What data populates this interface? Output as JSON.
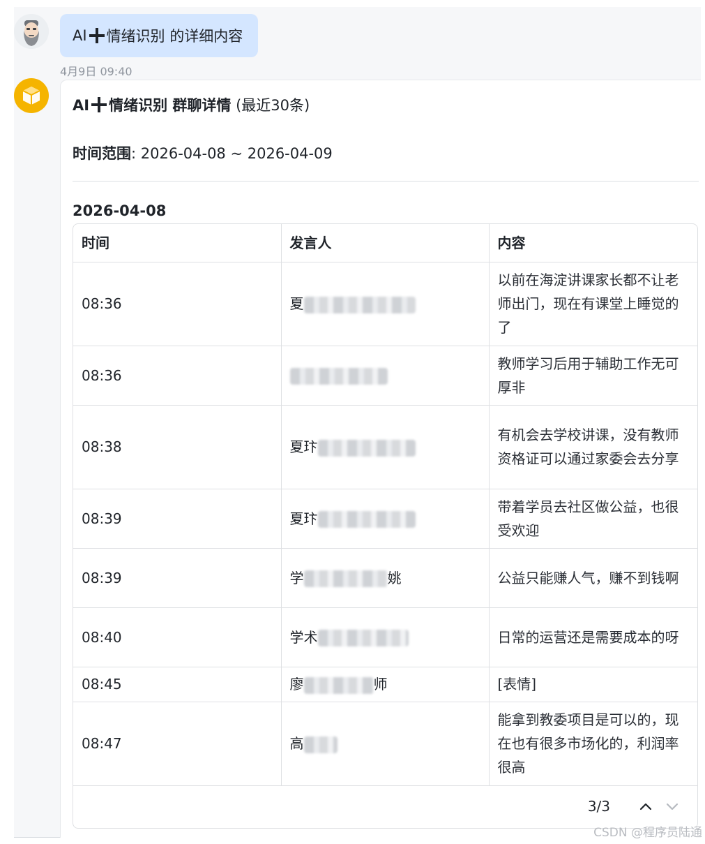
{
  "user_message": {
    "prefix": "AI",
    "suffix": "情绪识别  的详细内容",
    "timestamp": "4月9日 09:40"
  },
  "icons": {
    "user_avatar": "bearded-man-avatar",
    "bot_avatar": "cube-box-icon",
    "plus": "plus-icon",
    "pager_prev": "chevron-up-icon",
    "pager_next": "chevron-down-icon"
  },
  "colors": {
    "user_bubble": "#d4e6ff",
    "bot_avatar": "#f5b400",
    "border": "#dee0e3"
  },
  "bot_card": {
    "title_prefix": "AI",
    "title_bold": "情绪识别 群聊详情",
    "title_suffix": " (最近30条)",
    "range_label": "时间范围",
    "range_value": ": 2026-04-08 ~ 2026-04-09",
    "date_heading": "2026-04-08",
    "columns": [
      "时间",
      "发言人",
      "内容"
    ],
    "rows": [
      {
        "time": "08:36",
        "speaker": "夏",
        "content": "以前在海淀讲课家长都不让老师出门，现在有课堂上睡觉的了"
      },
      {
        "time": "08:36",
        "speaker": "",
        "content": "教师学习后用于辅助工作无可厚非"
      },
      {
        "time": "08:38",
        "speaker": "夏玣",
        "content": "有机会去学校讲课，没有教师资格证可以通过家委会去分享"
      },
      {
        "time": "08:39",
        "speaker": "夏玣",
        "content": "带着学员去社区做公益，也很受欢迎"
      },
      {
        "time": "08:39",
        "speaker": "学",
        "speaker_tail": "姚",
        "content": "公益只能赚人气，赚不到钱啊"
      },
      {
        "time": "08:40",
        "speaker": "学术",
        "content": "日常的运营还是需要成本的呀"
      },
      {
        "time": "08:45",
        "speaker": "廖",
        "speaker_tail": "师",
        "content": "[表情]"
      },
      {
        "time": "08:47",
        "speaker": "高",
        "content": "能拿到教委项目是可以的，现在也有很多市场化的，利润率很高"
      }
    ],
    "pager": "3/3"
  },
  "watermark": "CSDN @程序员陆通"
}
